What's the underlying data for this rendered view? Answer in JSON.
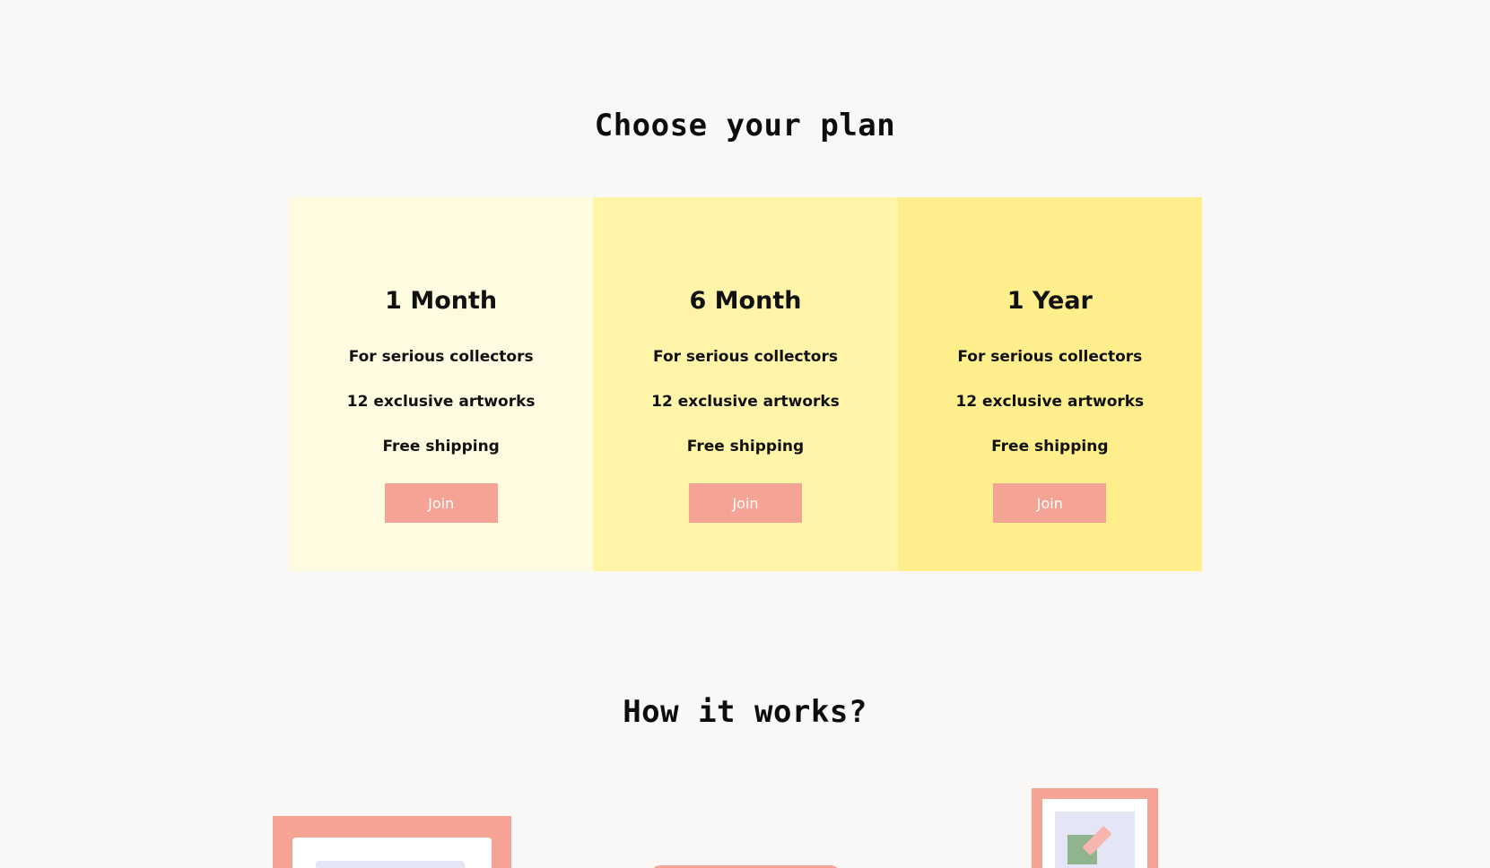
{
  "pricing": {
    "title": "Choose your plan",
    "plans": [
      {
        "name": "1 Month",
        "features": [
          "For serious collectors",
          "12 exclusive artworks",
          "Free shipping"
        ],
        "button_label": "Join",
        "background_color": "#fffbe0"
      },
      {
        "name": "6 Month",
        "features": [
          "For serious collectors",
          "12 exclusive artworks",
          "Free shipping"
        ],
        "button_label": "Join",
        "background_color": "#fff4a8"
      },
      {
        "name": "1 Year",
        "features": [
          "For serious collectors",
          "12 exclusive artworks",
          "Free shipping"
        ],
        "button_label": "Join",
        "background_color": "#ffee8c"
      }
    ]
  },
  "how_it_works": {
    "title": "How it works?",
    "illustrations": [
      "framed-artwork-icon",
      "pill-shape-icon",
      "paint-canvas-icon"
    ]
  },
  "colors": {
    "page_background": "#f9f8f6",
    "accent": "#f4a394",
    "text": "#111111",
    "button_text": "#ffffff"
  }
}
